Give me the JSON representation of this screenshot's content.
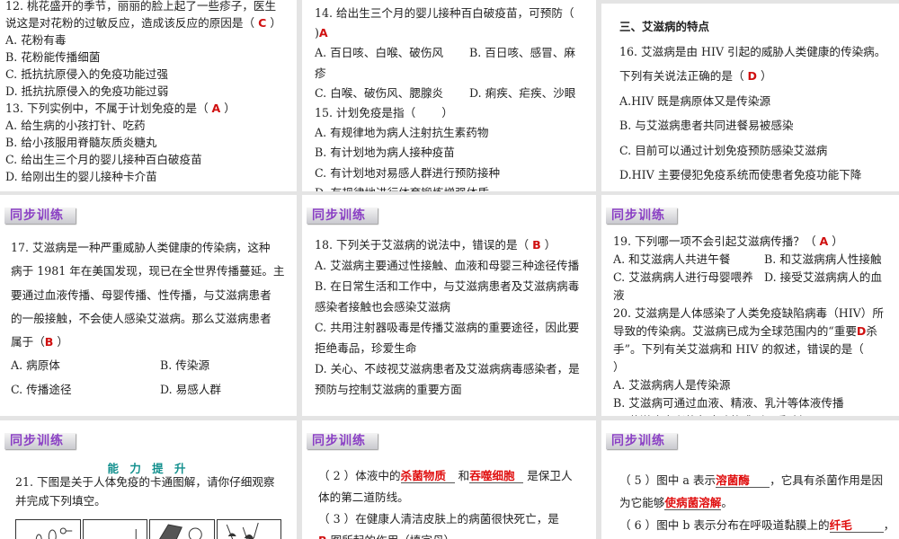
{
  "badge_label": "同步训练",
  "panels": [
    {
      "id": "p1",
      "lines": [
        [
          "12. 桃花盛开的季节，丽丽的脸上起了一些疹子，医生"
        ],
        [
          "说这是对花粉的过敏反应，造成该反应的原因是（ ",
          {
            "ans": "C"
          },
          " ）"
        ],
        [
          "A. 花粉有毒"
        ],
        [
          "B. 花粉能传播细菌"
        ],
        [
          "C. 抵抗抗原侵入的免疫功能过强"
        ],
        [
          "D. 抵抗抗原侵入的免疫功能过弱"
        ],
        [
          "13. 下列实例中，不属于计划免疫的是（ ",
          {
            "ans": "A"
          },
          "  ）"
        ],
        [
          "A. 给生病的小孩打针、吃药"
        ],
        [
          "B. 给小孩服用脊髓灰质炎糖丸"
        ],
        [
          "C. 给出生三个月的婴儿接种百白破疫苗"
        ],
        [
          "D. 给刚出生的婴儿接种卡介苗"
        ]
      ]
    },
    {
      "id": "p2",
      "lines": [
        [
          "14. 给出生三个月的婴儿接种百白破疫苗，可预防（"
        ],
        [
          "   )",
          {
            "ans": "A"
          }
        ],
        [
          "A. 百日咳、白喉、破伤风",
          {
            "col": "B. 百日咳、感冒、麻"
          }
        ],
        [
          "疹"
        ],
        [
          "C. 白喉、破伤风、腮腺炎",
          {
            "col": "D. 痢疾、疟疾、沙眼"
          }
        ],
        [
          "15. 计划免疫是指（　　 ）"
        ],
        [
          "A. 有规律地为病人注射抗生素药物"
        ],
        [
          "B. 有计划地为病人接种疫苗"
        ],
        [
          "C. 有计划地对易感人群进行预防接种"
        ],
        [
          "D. 有规律地进行体育锻炼增强体质"
        ]
      ]
    },
    {
      "id": "p3",
      "lines": [
        [
          {
            "heading": "三、艾滋病的特点"
          }
        ],
        [
          "16. 艾滋病是由 HIV 引起的威胁人类健康的传染病。"
        ],
        [
          "下列有关说法正确的是（  ",
          {
            "ans": "D"
          },
          "  ）"
        ],
        [
          "A.HIV 既是病原体又是传染源"
        ],
        [
          "B. 与艾滋病患者共同进餐易被感染"
        ],
        [
          "C. 目前可以通过计划免疫预防感染艾滋病"
        ],
        [
          "D.HIV 主要侵犯免疫系统而使患者免疫功能下降"
        ]
      ]
    },
    {
      "id": "p4",
      "badge": true,
      "lines": [
        [
          "17. 艾滋病是一种严重威胁人类健康的传染病，这种"
        ],
        [
          "病于 1981 年在美国发现，现已在全世界传播蔓延。主"
        ],
        [
          "要通过血液传播、母婴传播、性传播，与艾滋病患者"
        ],
        [
          "的一般接触，不会使人感染艾滋病。那么艾滋病患者"
        ],
        [
          "属于（",
          {
            "ans": "B"
          },
          "      ）"
        ],
        [
          "A. 病原体",
          {
            "col": "B. 传染源"
          }
        ],
        [
          "C. 传播途径",
          {
            "col": "D. 易感人群"
          }
        ]
      ]
    },
    {
      "id": "p5",
      "badge": true,
      "lines": [
        [
          "18. 下列关于艾滋病的说法中，错误的是（  ",
          {
            "ans": "B"
          },
          "  ）"
        ],
        [
          "A. 艾滋病主要通过性接触、血液和母婴三种途径传播"
        ],
        [
          "B. 在日常生活和工作中，与艾滋病患者及艾滋病病毒"
        ],
        [
          "感染者接触也会感染艾滋病"
        ],
        [
          "C. 共用注射器吸毒是传播艾滋病的重要途径，因此要"
        ],
        [
          "拒绝毒品，珍爱生命"
        ],
        [
          "D. 关心、不歧视艾滋病患者及艾滋病病毒感染者，是"
        ],
        [
          "预防与控制艾滋病的重要方面"
        ]
      ]
    },
    {
      "id": "p6",
      "badge": true,
      "lines": [
        [
          "19. 下列哪一项不会引起艾滋病传播？（  ",
          {
            "ans": "A"
          },
          "  ）"
        ],
        [
          "A. 和艾滋病人共进午餐",
          {
            "col": "B. 和艾滋病病人性接触"
          }
        ],
        [
          "C. 艾滋病病人进行母婴喂养",
          {
            "col": "D. 接受艾滋病病人的血"
          }
        ],
        [
          "液"
        ],
        [
          "20. 艾滋病是人体感染了人类免疫缺陷病毒（HIV）所"
        ],
        [
          "导致的传染病。艾滋病已成为全球范围内的“重要",
          {
            "ans": "D"
          },
          "杀"
        ],
        [
          "手”。下列有关艾滋病和 HIV 的叙述，错误的是（"
        ],
        [
          "）"
        ],
        [
          "A. 艾滋病病人是传染源"
        ],
        [
          "B. 艾滋病可通过血液、精液、乳汁等体液传播"
        ],
        [
          "C. 艾滋病患者的免疫功能遭到严重破坏"
        ]
      ]
    },
    {
      "id": "p7",
      "badge": true,
      "subtitle": "能 力 提 升",
      "lines": [
        [
          "21. 下图是关于人体免疫的卡通图解，请你仔细观察"
        ],
        [
          "并完成下列填空。"
        ]
      ]
    },
    {
      "id": "p8",
      "badge": true,
      "lines": [
        [
          "（ 2 ）体液中的",
          {
            "blank": "杀菌物质"
          },
          " 和",
          {
            "blank": "吞噬细胞"
          },
          " 是保卫人"
        ],
        [
          "体的第二道防线。"
        ],
        [
          "（ 3 ）在健康人清洁皮肤上的病菌很快死亡，是"
        ],
        [
          "    ",
          {
            "ans": "B"
          },
          "  图所起的作用（填字母）。"
        ]
      ]
    },
    {
      "id": "p9",
      "badge": true,
      "lines": [
        [
          "（ 5 ）图中 a 表示",
          {
            "blank": "溶菌酶"
          },
          "，它具有杀菌作用是因"
        ],
        [
          "为它能够",
          {
            "blank": "使病菌溶解"
          },
          "。"
        ],
        [
          "（ 6 ）图中 b 表示分布在呼吸道黏膜上的",
          {
            "blank": "纤毛"
          },
          "，"
        ]
      ]
    }
  ]
}
